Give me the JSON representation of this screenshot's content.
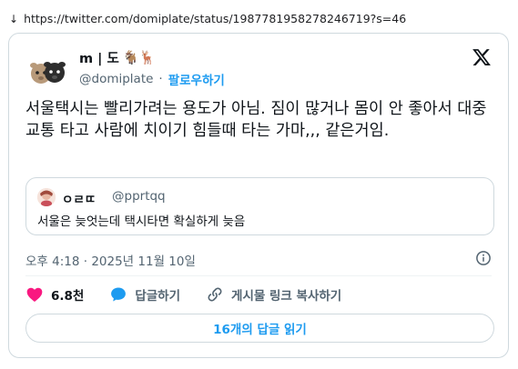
{
  "browser": {
    "url": "https://twitter.com/domiplate/status/1987781958278246719?s=46"
  },
  "author": {
    "display_name": "m | 도",
    "name_emoji": "🐐🦌",
    "handle": "@domiplate",
    "separator": "·",
    "follow_label": "팔로우하기"
  },
  "tweet": {
    "text": "서울택시는 빨리가려는 용도가 아님. 짐이 많거나 몸이 안 좋아서 대중교통 타고 사람에 치이기 힘들때 타는 가마,,, 같은거임."
  },
  "quote": {
    "display_name": "ㅇㄹㄸ",
    "handle": "@pprtqq",
    "text": "서울은 늦엇는데 택시타면 확실하게 늦음"
  },
  "meta": {
    "timestamp": "오후 4:18 · 2025년 11월 10일"
  },
  "actions": {
    "like_count": "6.8천",
    "reply_label": "답글하기",
    "share_label": "게시물 링크 복사하기"
  },
  "replies_button": {
    "label": "16개의 답글 읽기"
  },
  "colors": {
    "accent": "#1d9bf0",
    "like": "#f91880",
    "muted": "#536471",
    "border": "#cfd9de"
  },
  "icons": {
    "x_logo": "x-logo-icon",
    "info": "info-icon",
    "heart": "heart-icon",
    "reply": "speech-bubble-icon",
    "link": "link-icon",
    "download_arrow": "arrow-down-icon"
  }
}
